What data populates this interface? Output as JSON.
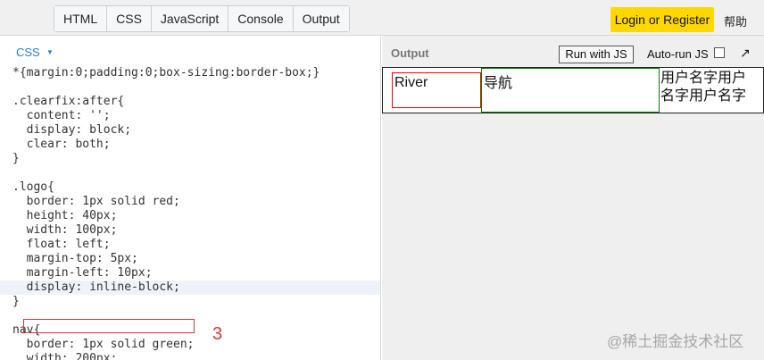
{
  "topbar": {
    "tabs": [
      "HTML",
      "CSS",
      "JavaScript",
      "Console",
      "Output"
    ],
    "login_label": "Login or Register",
    "help_label": "帮助"
  },
  "editor": {
    "lang_label": "CSS",
    "lines": {
      "l1": "*{margin:0;padding:0;box-sizing:border-box;}",
      "l3": ".clearfix:after{",
      "l4": "  content: '';",
      "l5": "  display: block;",
      "l6": "  clear: both;",
      "l7": "}",
      "l9": ".logo{",
      "l10": "  border: 1px solid red;",
      "l11": "  height: 40px;",
      "l12": "  width: 100px;",
      "l13": "  float: left;",
      "l14": "  margin-top: 5px;",
      "l15": "  margin-left: 10px;",
      "l16": "  display: inline-block;",
      "l17": "}",
      "l19": "nav{",
      "l20": "  border: 1px solid green;",
      "l21": "  width: 200px;"
    },
    "annotation": "3"
  },
  "output": {
    "title": "Output",
    "run_label": "Run with JS",
    "autorun_label": "Auto-run JS",
    "preview": {
      "logo_text": "River",
      "nav_text": "导航",
      "user_text": "用户名字用户名字用户名字"
    }
  },
  "watermark": "@稀土掘金技术社区"
}
